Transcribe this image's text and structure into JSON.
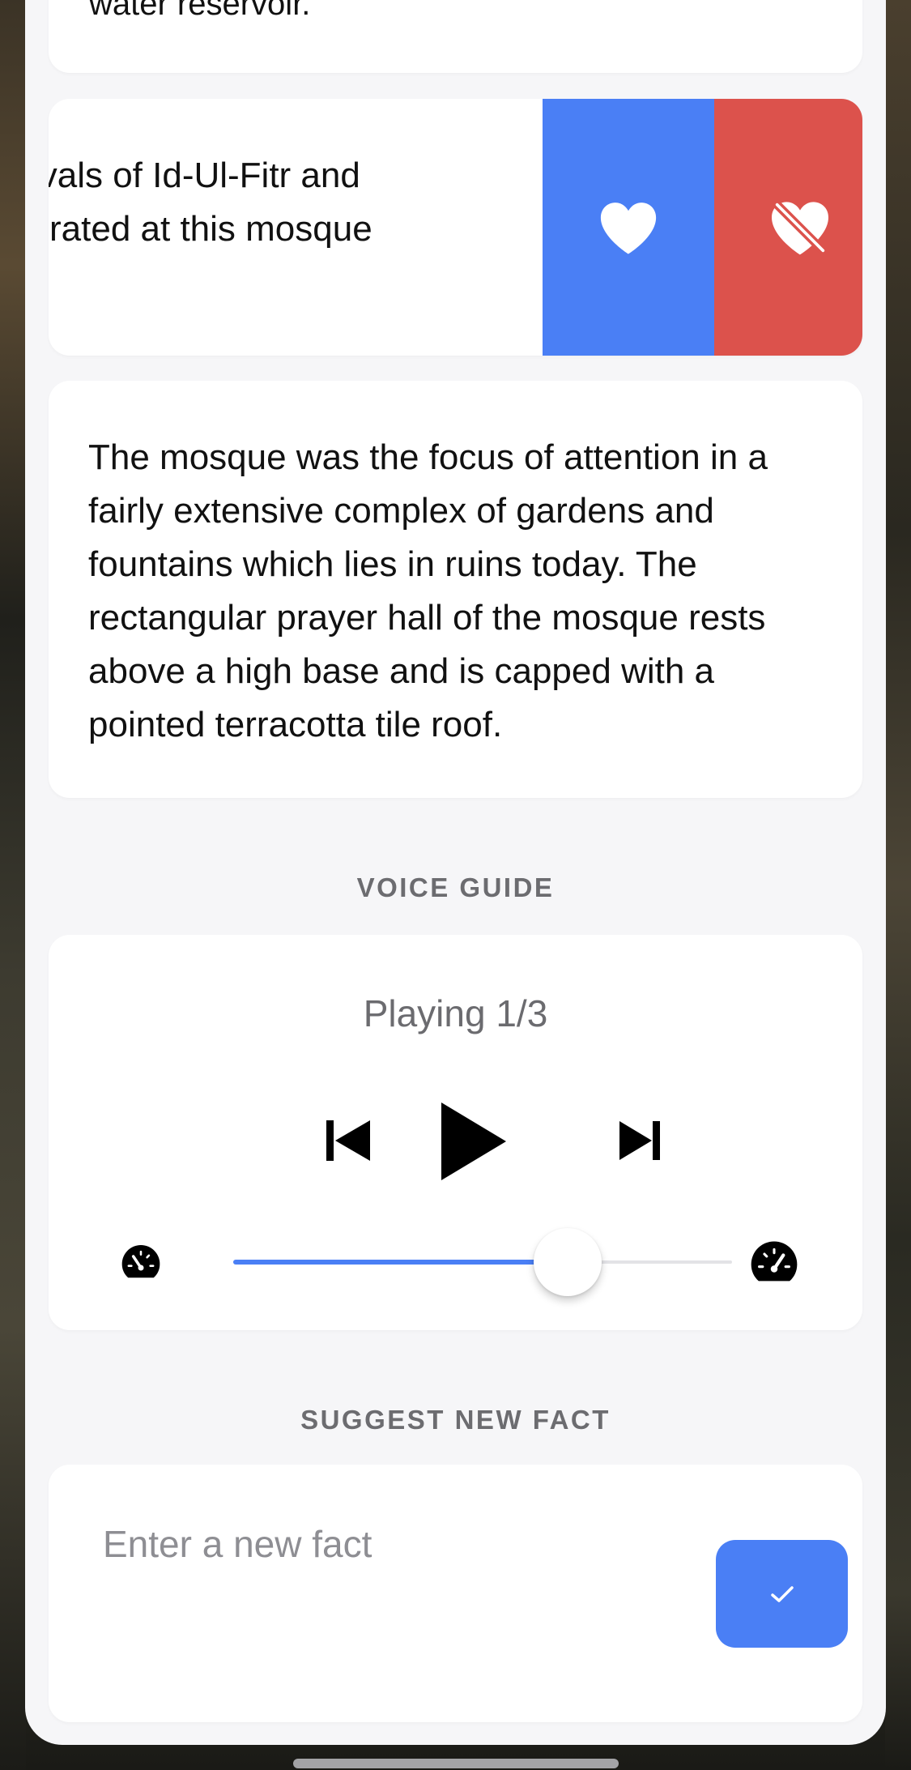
{
  "previous_fact": {
    "text": "water reservoir."
  },
  "swipe_fact": {
    "line1": "The festivals of Id-Ul-Fitr and",
    "line2": "are celebrated at this mosque",
    "like_icon": "heart-icon",
    "unlike_icon": "heart-slash-icon",
    "like_color": "#4a7ff5",
    "unlike_color": "#dc524c"
  },
  "description": {
    "text": "The mosque was the focus of attention in a fairly extensive complex of gardens and fountains which lies in ruins today. The rectangular prayer hall of the mosque rests above a high base and is capped with a pointed terracotta tile roof."
  },
  "voice_guide": {
    "title": "VOICE GUIDE",
    "status": "Playing 1/3",
    "controls": [
      "skip-back-icon",
      "play-icon",
      "skip-forward-icon"
    ],
    "speed": {
      "min_icon": "speedometer-slow-icon",
      "max_icon": "speedometer-fast-icon",
      "value": 0.67
    }
  },
  "suggest": {
    "title": "SUGGEST NEW FACT",
    "placeholder": "Enter a new fact",
    "value": "",
    "submit_icon": "checkmark-icon",
    "accent": "#4a7ff5"
  }
}
